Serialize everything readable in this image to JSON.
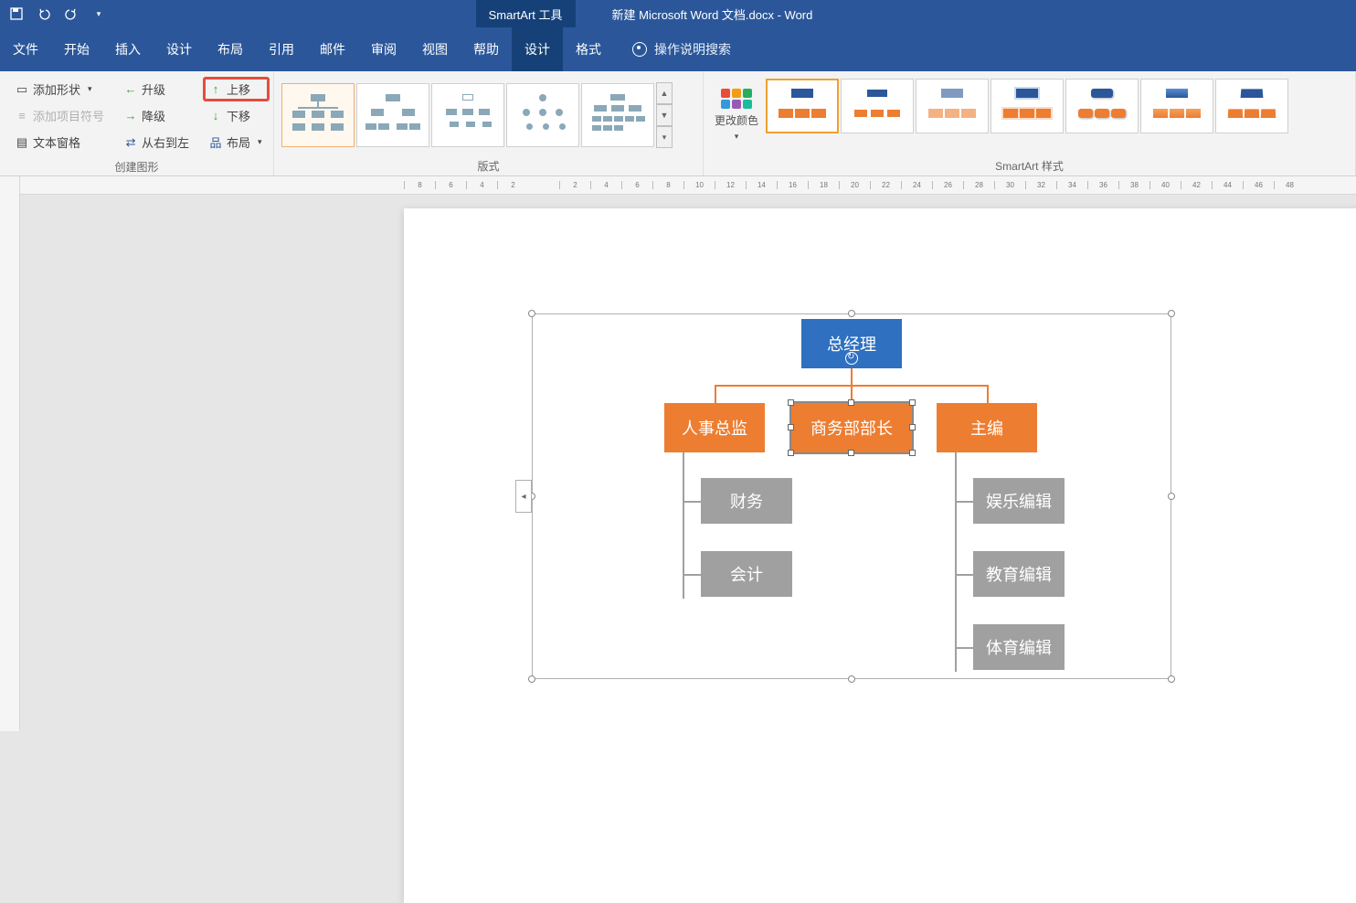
{
  "titlebar": {
    "smartart_tools": "SmartArt 工具",
    "doc_title": "新建 Microsoft Word 文档.docx  -  Word"
  },
  "tabs": {
    "file": "文件",
    "home": "开始",
    "insert": "插入",
    "design": "设计",
    "layout": "布局",
    "references": "引用",
    "mailings": "邮件",
    "review": "审阅",
    "view": "视图",
    "help": "帮助",
    "sa_design": "设计",
    "sa_format": "格式",
    "tell_me": "操作说明搜索"
  },
  "ribbon": {
    "group_create": "创建图形",
    "group_layouts": "版式",
    "group_styles": "SmartArt 样式",
    "add_shape": "添加形状",
    "add_bullet": "添加项目符号",
    "text_pane": "文本窗格",
    "promote": "升级",
    "demote": "降级",
    "rtl": "从右到左",
    "move_up": "上移",
    "move_down": "下移",
    "layout_btn": "布局",
    "change_colors": "更改颜色"
  },
  "chart_data": {
    "type": "org-chart",
    "root": {
      "label": "总经理",
      "color": "blue"
    },
    "children": [
      {
        "label": "人事总监",
        "color": "orange",
        "children": [
          {
            "label": "财务",
            "color": "gray"
          },
          {
            "label": "会计",
            "color": "gray"
          }
        ]
      },
      {
        "label": "商务部部长",
        "color": "orange",
        "selected": true,
        "children": []
      },
      {
        "label": "主编",
        "color": "orange",
        "children": [
          {
            "label": "娱乐编辑",
            "color": "gray"
          },
          {
            "label": "教育编辑",
            "color": "gray"
          },
          {
            "label": "体育编辑",
            "color": "gray"
          }
        ]
      }
    ]
  },
  "ruler_marks": [
    "8",
    "6",
    "4",
    "2",
    "",
    "2",
    "4",
    "6",
    "8",
    "10",
    "12",
    "14",
    "16",
    "18",
    "20",
    "22",
    "24",
    "26",
    "28",
    "30",
    "32",
    "34",
    "36",
    "38",
    "40",
    "42",
    "44",
    "46",
    "48"
  ]
}
